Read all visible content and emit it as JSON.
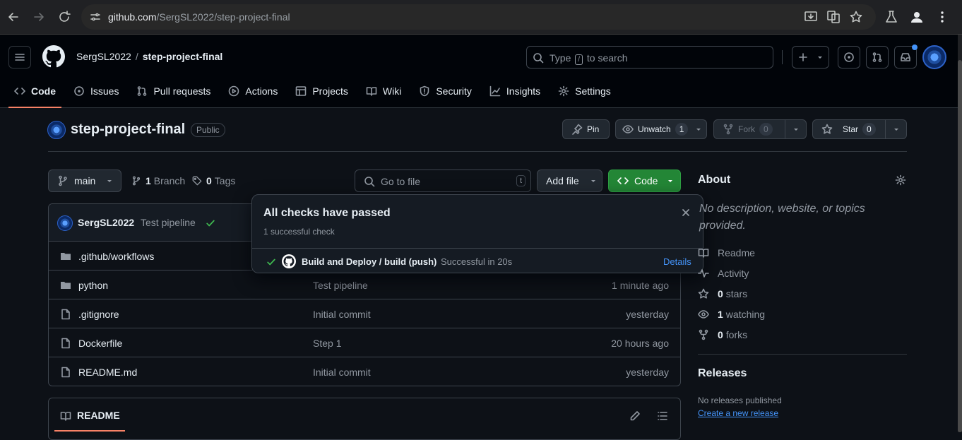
{
  "browser": {
    "url_host": "github.com",
    "url_path": "/SergSL2022/step-project-final"
  },
  "header": {
    "owner": "SergSL2022",
    "separator": "/",
    "repo": "step-project-final",
    "search_pre": "Type ",
    "search_key": "/",
    "search_post": " to search"
  },
  "tabs": [
    {
      "label": "Code",
      "icon": "code-icon"
    },
    {
      "label": "Issues",
      "icon": "issue-icon"
    },
    {
      "label": "Pull requests",
      "icon": "pull-request-icon"
    },
    {
      "label": "Actions",
      "icon": "play-icon"
    },
    {
      "label": "Projects",
      "icon": "table-icon"
    },
    {
      "label": "Wiki",
      "icon": "book-icon"
    },
    {
      "label": "Security",
      "icon": "shield-icon"
    },
    {
      "label": "Insights",
      "icon": "graph-icon"
    },
    {
      "label": "Settings",
      "icon": "gear-icon"
    }
  ],
  "repo": {
    "title": "step-project-final",
    "visibility": "Public",
    "pin_label": "Pin",
    "unwatch_label": "Unwatch",
    "unwatch_count": "1",
    "fork_label": "Fork",
    "fork_count": "0",
    "star_label": "Star",
    "star_count": "0"
  },
  "controls": {
    "branch": "main",
    "branch_count": "1",
    "branch_label": "Branch",
    "tag_count": "0",
    "tag_label": "Tags",
    "goto_placeholder": "Go to file",
    "goto_key": "t",
    "add_file": "Add file",
    "code": "Code"
  },
  "latest_commit": {
    "user": "SergSL2022",
    "message": "Test pipeline"
  },
  "files": [
    {
      "name": ".github/workflows",
      "type": "dir",
      "message": "",
      "time": ""
    },
    {
      "name": "python",
      "type": "dir",
      "message": "Test pipeline",
      "time": "1 minute ago"
    },
    {
      "name": ".gitignore",
      "type": "file",
      "message": "Initial commit",
      "time": "yesterday"
    },
    {
      "name": "Dockerfile",
      "type": "file",
      "message": "Step 1",
      "time": "20 hours ago"
    },
    {
      "name": "README.md",
      "type": "file",
      "message": "Initial commit",
      "time": "yesterday"
    }
  ],
  "readme": {
    "title": "README"
  },
  "popover": {
    "title": "All checks have passed",
    "subtitle": "1 successful check",
    "check_name": "Build and Deploy / build (push)",
    "check_status": "Successful in 20s",
    "details": "Details"
  },
  "about": {
    "title": "About",
    "description": "No description, website, or topics provided.",
    "readme": "Readme",
    "activity": "Activity",
    "stars_count": "0",
    "stars_label": "stars",
    "watching_count": "1",
    "watching_label": "watching",
    "forks_count": "0",
    "forks_label": "forks"
  },
  "releases": {
    "title": "Releases",
    "none": "No releases published",
    "create": "Create a new release"
  },
  "colors": {
    "accent_green": "#238636",
    "success": "#3fb950",
    "link": "#4493f8",
    "active_tab": "#f78166"
  }
}
